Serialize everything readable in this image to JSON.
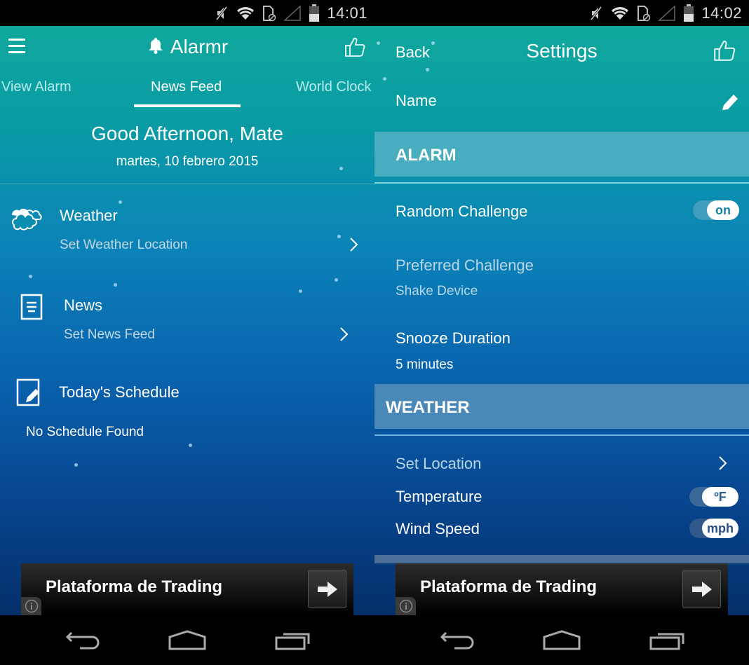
{
  "left": {
    "status": {
      "time": "14:01"
    },
    "header": {
      "title": "Alarmr"
    },
    "tabs": [
      {
        "label": "View Alarm",
        "active": false
      },
      {
        "label": "News Feed",
        "active": true
      },
      {
        "label": "World Clock",
        "active": false
      }
    ],
    "greeting": "Good Afternoon, Mate",
    "date": "martes, 10 febrero 2015",
    "feed": [
      {
        "title": "Weather",
        "subtitle": "Set Weather Location",
        "icon": "clouds-icon"
      },
      {
        "title": "News",
        "subtitle": "Set News Feed",
        "icon": "document-icon"
      },
      {
        "title": "Today's Schedule",
        "subtitle": "No Schedule Found",
        "icon": "edit-note-icon"
      }
    ],
    "ad": {
      "text": "Plataforma de Trading"
    }
  },
  "right": {
    "status": {
      "time": "14:02"
    },
    "header": {
      "back_label": "Back",
      "title": "Settings"
    },
    "name_label": "Name",
    "sections": {
      "alarm": {
        "title": "ALARM",
        "random_challenge": {
          "label": "Random Challenge",
          "toggle": "on"
        },
        "preferred_challenge": {
          "label": "Preferred Challenge",
          "value": "Shake Device"
        },
        "snooze": {
          "label": "Snooze Duration",
          "value": "5 minutes"
        }
      },
      "weather": {
        "title": "WEATHER",
        "set_location": {
          "label": "Set Location"
        },
        "temperature": {
          "label": "Temperature",
          "toggle": "ºF"
        },
        "wind_speed": {
          "label": "Wind Speed",
          "toggle": "mph"
        }
      }
    },
    "ad": {
      "text": "Plataforma de Trading"
    }
  },
  "colors": {
    "teal_top": "#0fa89c",
    "blue_mid": "#0962ad",
    "navy_bottom": "#052f6a",
    "alarm_header": "#48adbf",
    "weather_header": "#4a88b8"
  }
}
